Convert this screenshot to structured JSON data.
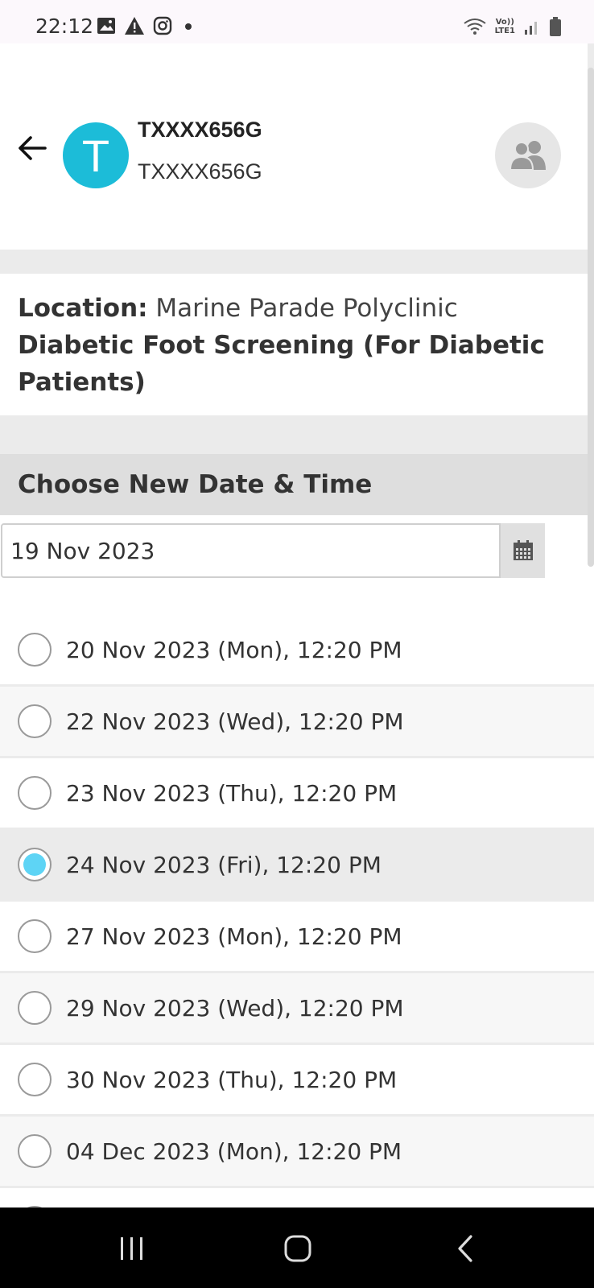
{
  "status_bar": {
    "time": "22:12",
    "left_icons": [
      "gallery-icon",
      "warning-icon",
      "instagram-icon",
      "dot-icon"
    ],
    "right_icons": [
      "wifi-icon",
      "volte-icon",
      "signal-icon",
      "battery-icon"
    ],
    "volte_label": "Vo))",
    "lte_label": "LTE1"
  },
  "header": {
    "avatar_letter": "T",
    "user_name": "TXXXX656G",
    "user_id": "TXXXX656G"
  },
  "location": {
    "label": "Location:",
    "value": "Marine Parade Polyclinic",
    "service": "Diabetic Foot Screening (For Diabetic Patients)"
  },
  "section": {
    "title": "Choose New Date & Time"
  },
  "date_picker": {
    "value": "19 Nov 2023"
  },
  "slots": [
    {
      "label": "20 Nov 2023 (Mon), 12:20 PM",
      "selected": false
    },
    {
      "label": "22 Nov 2023 (Wed), 12:20 PM",
      "selected": false
    },
    {
      "label": "23 Nov 2023 (Thu), 12:20 PM",
      "selected": false
    },
    {
      "label": "24 Nov 2023 (Fri), 12:20 PM",
      "selected": true
    },
    {
      "label": "27 Nov 2023 (Mon), 12:20 PM",
      "selected": false
    },
    {
      "label": "29 Nov 2023 (Wed), 12:20 PM",
      "selected": false
    },
    {
      "label": "30 Nov 2023 (Thu), 12:20 PM",
      "selected": false
    },
    {
      "label": "04 Dec 2023 (Mon), 12:20 PM",
      "selected": false
    }
  ],
  "colors": {
    "avatar": "#1cbcd8",
    "radio_selected": "#5ed4f5"
  }
}
